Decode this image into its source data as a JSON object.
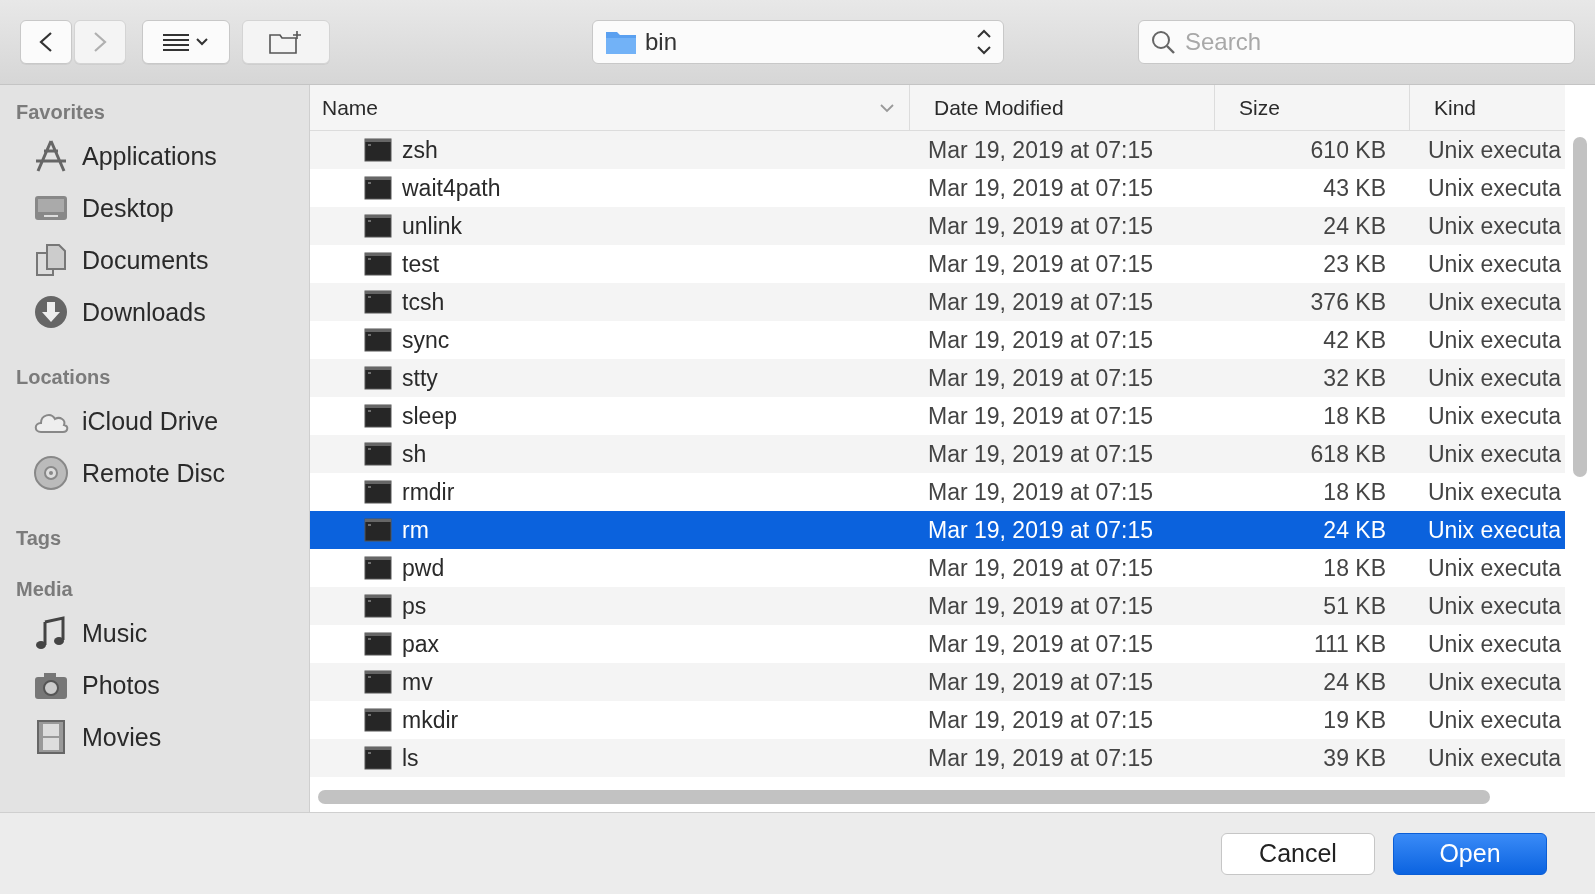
{
  "toolbar": {
    "nav": [
      {
        "kind": "back",
        "disabled": false
      },
      {
        "kind": "forward",
        "disabled": true
      }
    ],
    "view_button": {
      "kind": "list"
    },
    "new_folder": {
      "disabled": true
    },
    "location": {
      "label": "bin"
    },
    "search": {
      "placeholder": "Search"
    }
  },
  "sidebar": {
    "sections": [
      {
        "title": "Favorites",
        "items": [
          {
            "label": "Applications",
            "kind": "apps"
          },
          {
            "label": "Desktop",
            "kind": "desktop"
          },
          {
            "label": "Documents",
            "kind": "documents"
          },
          {
            "label": "Downloads",
            "kind": "downloads"
          }
        ]
      },
      {
        "title": "Locations",
        "items": [
          {
            "label": "iCloud Drive",
            "kind": "cloud"
          },
          {
            "label": "Remote Disc",
            "kind": "disc"
          }
        ]
      },
      {
        "title": "Tags"
      },
      {
        "title": "Media",
        "items": [
          {
            "label": "Music",
            "kind": "music"
          },
          {
            "label": "Photos",
            "kind": "camera"
          },
          {
            "label": "Movies",
            "kind": "film"
          }
        ]
      }
    ]
  },
  "table": {
    "columns": [
      {
        "label": "Name",
        "sorted": true
      },
      {
        "label": "Date Modified",
        "sorted": false
      },
      {
        "label": "Size",
        "sorted": false
      },
      {
        "label": "Kind",
        "sorted": false
      }
    ],
    "rows": [
      {
        "name": "zsh",
        "date": "Mar 19, 2019 at 07:15",
        "size": "610 KB",
        "kind": "Unix executa",
        "selected": false
      },
      {
        "name": "wait4path",
        "date": "Mar 19, 2019 at 07:15",
        "size": "43 KB",
        "kind": "Unix executa",
        "selected": false
      },
      {
        "name": "unlink",
        "date": "Mar 19, 2019 at 07:15",
        "size": "24 KB",
        "kind": "Unix executa",
        "selected": false
      },
      {
        "name": "test",
        "date": "Mar 19, 2019 at 07:15",
        "size": "23 KB",
        "kind": "Unix executa",
        "selected": false
      },
      {
        "name": "tcsh",
        "date": "Mar 19, 2019 at 07:15",
        "size": "376 KB",
        "kind": "Unix executa",
        "selected": false
      },
      {
        "name": "sync",
        "date": "Mar 19, 2019 at 07:15",
        "size": "42 KB",
        "kind": "Unix executa",
        "selected": false
      },
      {
        "name": "stty",
        "date": "Mar 19, 2019 at 07:15",
        "size": "32 KB",
        "kind": "Unix executa",
        "selected": false
      },
      {
        "name": "sleep",
        "date": "Mar 19, 2019 at 07:15",
        "size": "18 KB",
        "kind": "Unix executa",
        "selected": false
      },
      {
        "name": "sh",
        "date": "Mar 19, 2019 at 07:15",
        "size": "618 KB",
        "kind": "Unix executa",
        "selected": false
      },
      {
        "name": "rmdir",
        "date": "Mar 19, 2019 at 07:15",
        "size": "18 KB",
        "kind": "Unix executa",
        "selected": false
      },
      {
        "name": "rm",
        "date": "Mar 19, 2019 at 07:15",
        "size": "24 KB",
        "kind": "Unix executa",
        "selected": true
      },
      {
        "name": "pwd",
        "date": "Mar 19, 2019 at 07:15",
        "size": "18 KB",
        "kind": "Unix executa",
        "selected": false
      },
      {
        "name": "ps",
        "date": "Mar 19, 2019 at 07:15",
        "size": "51 KB",
        "kind": "Unix executa",
        "selected": false
      },
      {
        "name": "pax",
        "date": "Mar 19, 2019 at 07:15",
        "size": "111 KB",
        "kind": "Unix executa",
        "selected": false
      },
      {
        "name": "mv",
        "date": "Mar 19, 2019 at 07:15",
        "size": "24 KB",
        "kind": "Unix executa",
        "selected": false
      },
      {
        "name": "mkdir",
        "date": "Mar 19, 2019 at 07:15",
        "size": "19 KB",
        "kind": "Unix executa",
        "selected": false
      },
      {
        "name": "ls",
        "date": "Mar 19, 2019 at 07:15",
        "size": "39 KB",
        "kind": "Unix executa",
        "selected": false
      }
    ]
  },
  "buttons": [
    {
      "label": "Cancel",
      "kind": "normal"
    },
    {
      "label": "Open",
      "kind": "default"
    }
  ]
}
